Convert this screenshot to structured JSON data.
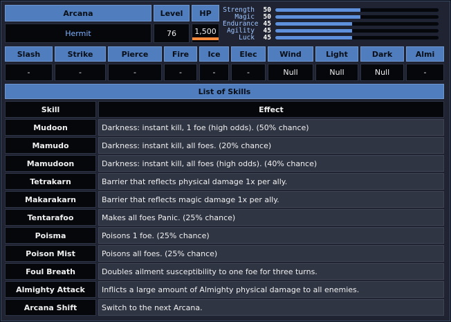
{
  "header": {
    "arcana_label": "Arcana",
    "level_label": "Level",
    "hp_label": "HP",
    "arcana_value": "Hermit",
    "level_value": "76",
    "hp_value": "1,500"
  },
  "stats": [
    {
      "name": "Strength",
      "value": "50",
      "fraction": 0.52
    },
    {
      "name": "Magic",
      "value": "50",
      "fraction": 0.52
    },
    {
      "name": "Endurance",
      "value": "45",
      "fraction": 0.47
    },
    {
      "name": "Agility",
      "value": "45",
      "fraction": 0.47
    },
    {
      "name": "Luck",
      "value": "45",
      "fraction": 0.47
    }
  ],
  "affinities": {
    "headers": [
      "Slash",
      "Strike",
      "Pierce",
      "Fire",
      "Ice",
      "Elec",
      "Wind",
      "Light",
      "Dark",
      "Almi"
    ],
    "values": [
      "-",
      "-",
      "-",
      "-",
      "-",
      "-",
      "Null",
      "Null",
      "Null",
      "-"
    ]
  },
  "skills_section": {
    "title": "List of Skills",
    "col_skill": "Skill",
    "col_effect": "Effect",
    "rows": [
      {
        "skill": "Mudoon",
        "effect": "Darkness: instant kill, 1 foe (high odds). (50% chance)"
      },
      {
        "skill": "Mamudo",
        "effect": "Darkness: instant kill, all foes. (20% chance)"
      },
      {
        "skill": "Mamudoon",
        "effect": "Darkness: instant kill, all foes (high odds). (40% chance)"
      },
      {
        "skill": "Tetrakarn",
        "effect": "Barrier that reflects physical damage 1x per ally."
      },
      {
        "skill": "Makarakarn",
        "effect": "Barrier that reflects magic damage 1x per ally."
      },
      {
        "skill": "Tentarafoo",
        "effect": "Makes all foes Panic. (25% chance)"
      },
      {
        "skill": "Poisma",
        "effect": "Poisons 1 foe. (25% chance)"
      },
      {
        "skill": "Poison Mist",
        "effect": "Poisons all foes. (25% chance)"
      },
      {
        "skill": "Foul Breath",
        "effect": "Doubles ailment susceptibility to one foe for three turns."
      },
      {
        "skill": "Almighty Attack",
        "effect": "Inflicts a large amount of Almighty physical damage to all enemies."
      },
      {
        "skill": "Arcana Shift",
        "effect": "Switch to the next Arcana."
      }
    ]
  }
}
